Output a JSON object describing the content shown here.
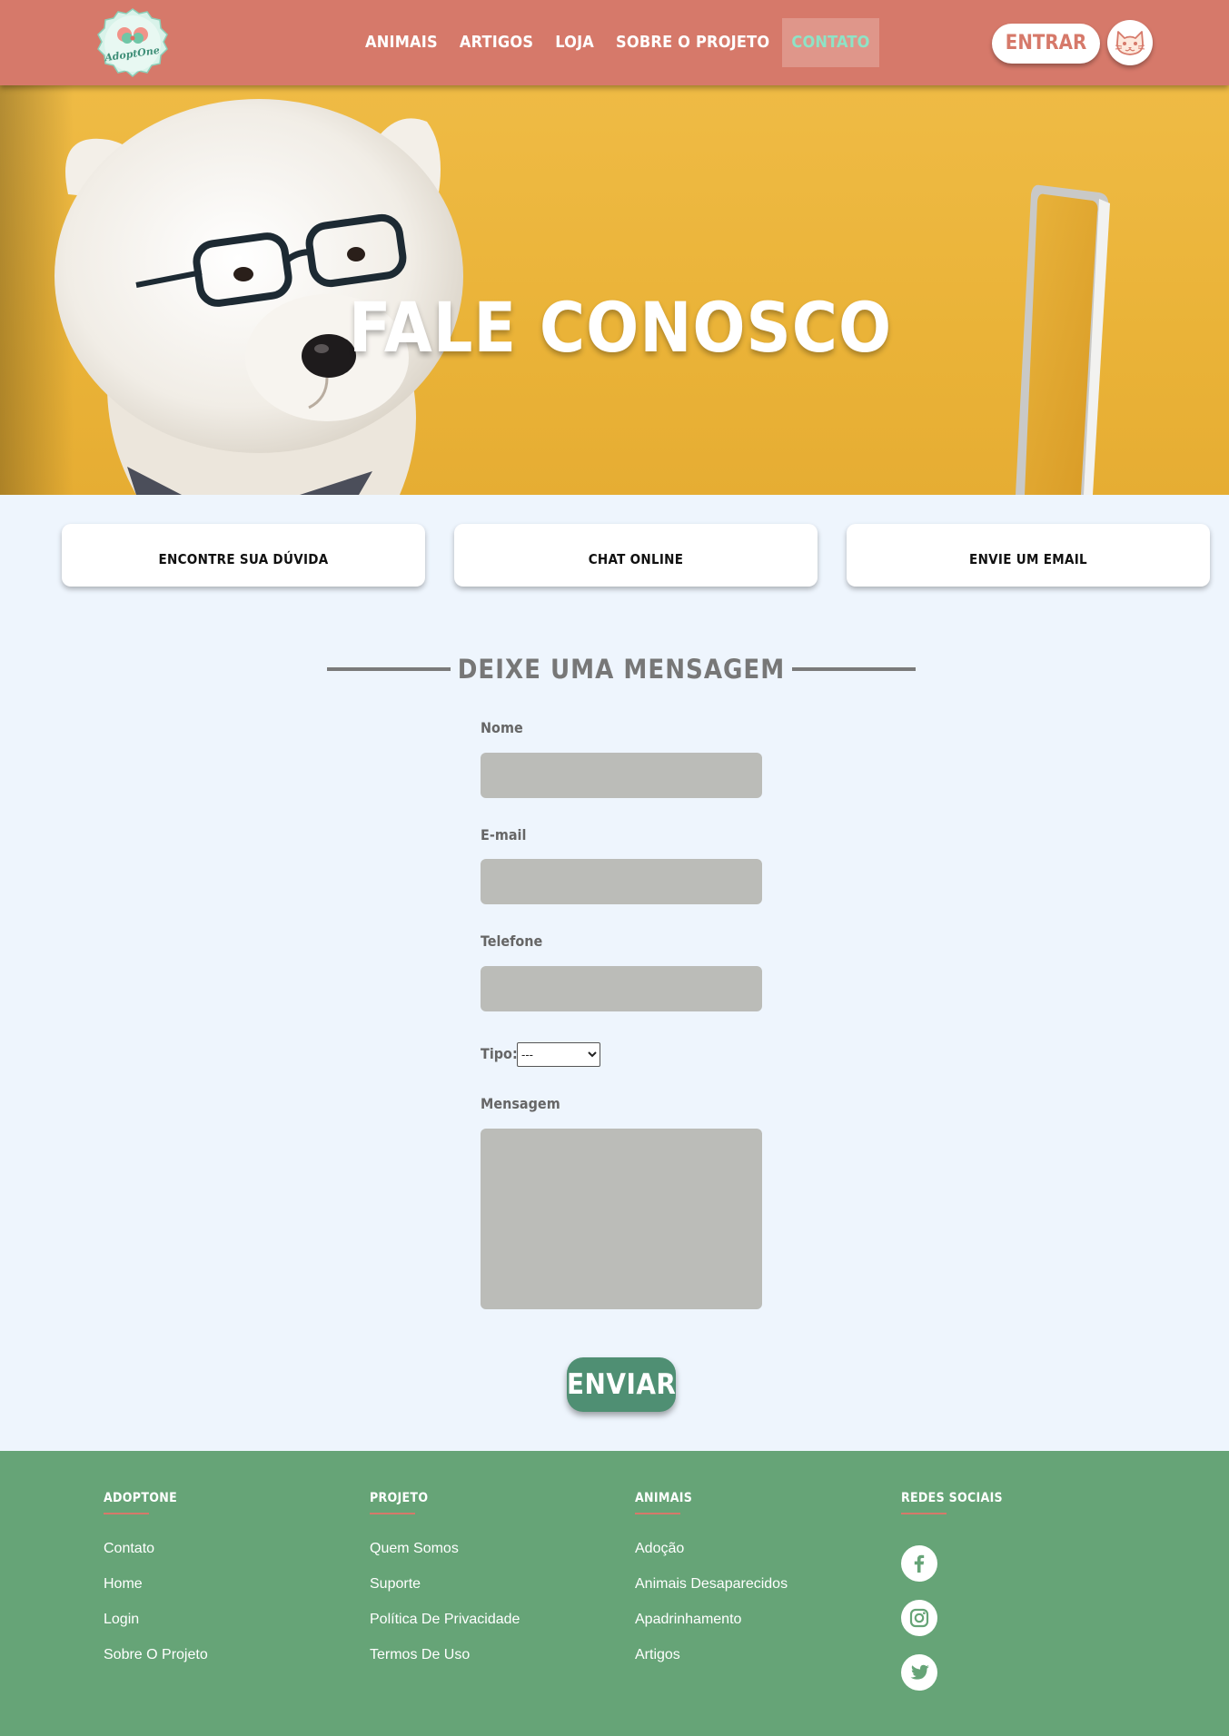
{
  "header": {
    "logo_text": "AdoptOne",
    "nav": [
      {
        "label": "ANIMAIS"
      },
      {
        "label": "ARTIGOS"
      },
      {
        "label": "LOJA"
      },
      {
        "label": "SOBRE O PROJETO"
      },
      {
        "label": "CONTATO",
        "active": true
      }
    ],
    "login_label": "ENTRAR",
    "avatar_icon": "cat-face-icon",
    "colors": {
      "bar": "#d6796a",
      "active_text": "#8ee3c6"
    }
  },
  "hero": {
    "title": "FALE CONOSCO",
    "image": "white dog with glasses next to laptop on yellow background"
  },
  "cards": [
    {
      "label": "ENCONTRE SUA DÚVIDA"
    },
    {
      "label": "CHAT ONLINE"
    },
    {
      "label": "ENVIE UM EMAIL"
    }
  ],
  "form": {
    "title": "DEIXE UMA MENSAGEM",
    "name_label": "Nome",
    "email_label": "E-mail",
    "phone_label": "Telefone",
    "type_label": "Tipo:",
    "type_selected": "---",
    "message_label": "Mensagem",
    "submit_label": "ENVIAR",
    "colors": {
      "input_bg": "#bbbcb8",
      "submit_bg": "#4f8f73"
    }
  },
  "footer": {
    "columns": [
      {
        "title": "ADOPTONE",
        "links": [
          "Contato",
          "Home",
          "Login",
          "Sobre O Projeto"
        ]
      },
      {
        "title": "PROJETO",
        "links": [
          "Quem Somos",
          "Suporte",
          "Política De Privacidade",
          "Termos De Uso"
        ]
      },
      {
        "title": "ANIMAIS",
        "links": [
          "Adoção",
          "Animais Desaparecidos",
          "Apadrinhamento",
          "Artigos"
        ]
      },
      {
        "title": "REDES SOCIAIS",
        "social": [
          "facebook-icon",
          "instagram-icon",
          "twitter-icon"
        ]
      }
    ],
    "colors": {
      "bg": "#66a477",
      "underline": "#d6796a"
    }
  }
}
